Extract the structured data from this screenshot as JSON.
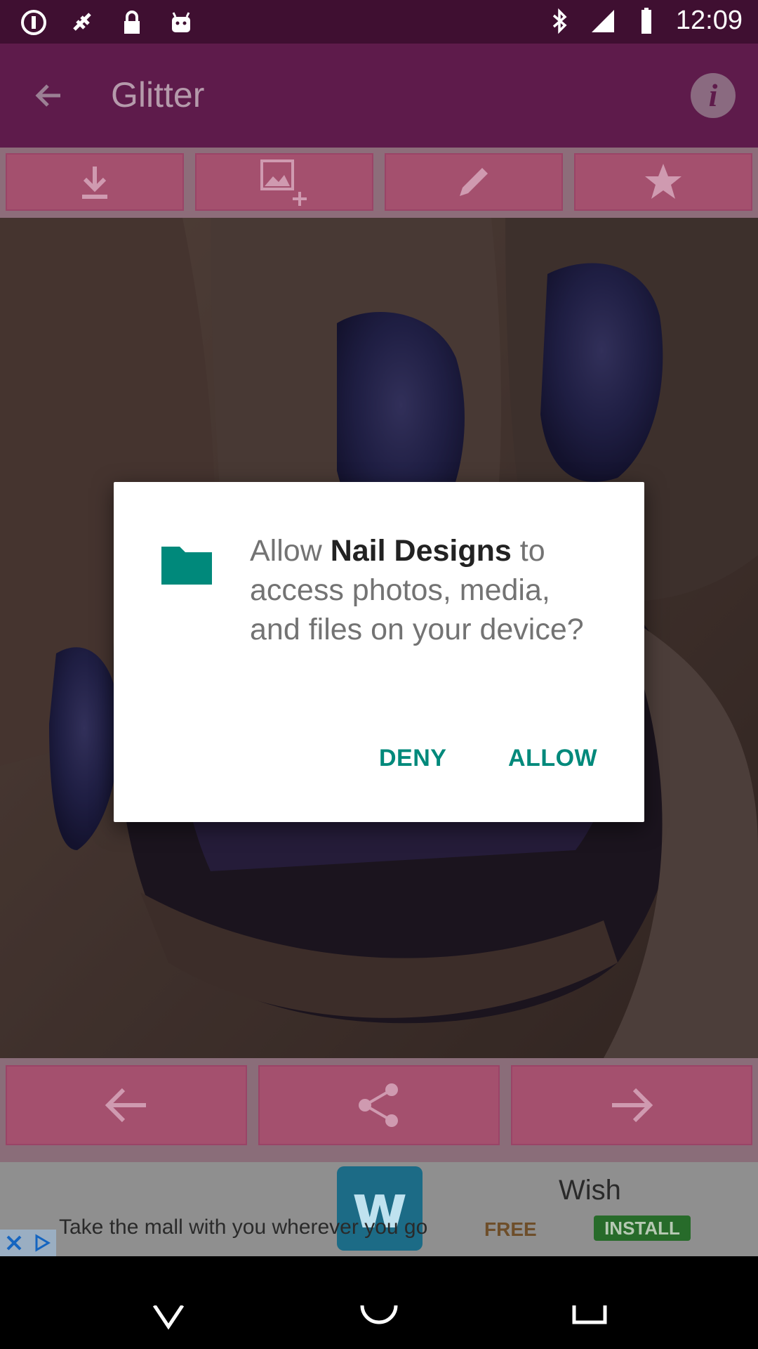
{
  "status_bar": {
    "time": "12:09"
  },
  "app_bar": {
    "title": "Glitter",
    "info_label": "i"
  },
  "toolbar": [
    {
      "icon": "download-icon"
    },
    {
      "icon": "add-image-icon"
    },
    {
      "icon": "pencil-icon"
    },
    {
      "icon": "star-icon"
    }
  ],
  "bottom_nav": [
    {
      "icon": "arrow-left-icon"
    },
    {
      "icon": "share-icon"
    },
    {
      "icon": "arrow-right-icon"
    }
  ],
  "dialog": {
    "message_prefix": "Allow ",
    "app_name": "Nail Designs",
    "message_suffix": " to access photos, media, and files on your device?",
    "deny_label": "DENY",
    "allow_label": "ALLOW",
    "accent_color": "#00897b"
  },
  "ad": {
    "logo_letter": "w",
    "brand": "Wish",
    "tagline": "Take the mall with you wherever you go",
    "free_label": "FREE",
    "install_label": "INSTALL"
  }
}
